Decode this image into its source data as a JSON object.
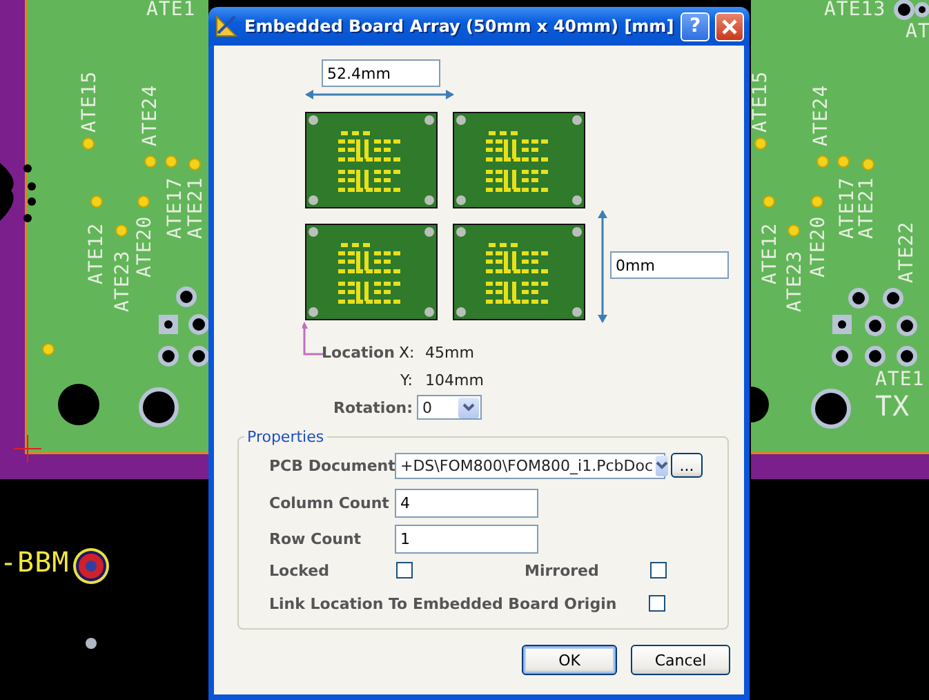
{
  "pcb": {
    "labels": [
      {
        "text": "ATE1"
      },
      {
        "text": "ATE15"
      },
      {
        "text": "ATE24"
      },
      {
        "text": "ATE17"
      },
      {
        "text": "ATE21"
      },
      {
        "text": "ATE12"
      },
      {
        "text": "ATE20"
      },
      {
        "text": "ATE23"
      },
      {
        "text": "-BBM"
      },
      {
        "text": "ATE13"
      },
      {
        "text": "AT"
      },
      {
        "text": "ATE15"
      },
      {
        "text": "ATE24"
      },
      {
        "text": "ATE17"
      },
      {
        "text": "ATE21"
      },
      {
        "text": "ATE12"
      },
      {
        "text": "ATE20"
      },
      {
        "text": "ATE23"
      },
      {
        "text": "ATE22"
      },
      {
        "text": "ATE1"
      },
      {
        "text": "TX"
      }
    ]
  },
  "dialog": {
    "title": "Embedded Board Array (50mm x 40mm) [mm]",
    "help_button": "?",
    "width_field": {
      "value": "52.4mm"
    },
    "spacing_field": {
      "value": "0mm"
    },
    "location": {
      "label": "Location",
      "x_label": "X:",
      "x_value": "45mm",
      "y_label": "Y:",
      "y_value": "104mm"
    },
    "rotation": {
      "label": "Rotation:",
      "value": "0"
    },
    "properties": {
      "title": "Properties",
      "pcb_document": {
        "label": "PCB Document",
        "value": "+DS\\FOM800\\FOM800_i1.PcbDoc"
      },
      "browse_button": "...",
      "column_count": {
        "label": "Column Count",
        "value": "4"
      },
      "row_count": {
        "label": "Row Count",
        "value": "1"
      },
      "checkboxes": [
        {
          "label": "Locked",
          "checked": false
        },
        {
          "label": "Mirrored",
          "checked": false
        },
        {
          "label": "Link Location To Embedded Board Origin",
          "checked": false
        }
      ]
    },
    "buttons": [
      {
        "label": "OK",
        "default": true
      },
      {
        "label": "Cancel",
        "default": false
      }
    ]
  }
}
